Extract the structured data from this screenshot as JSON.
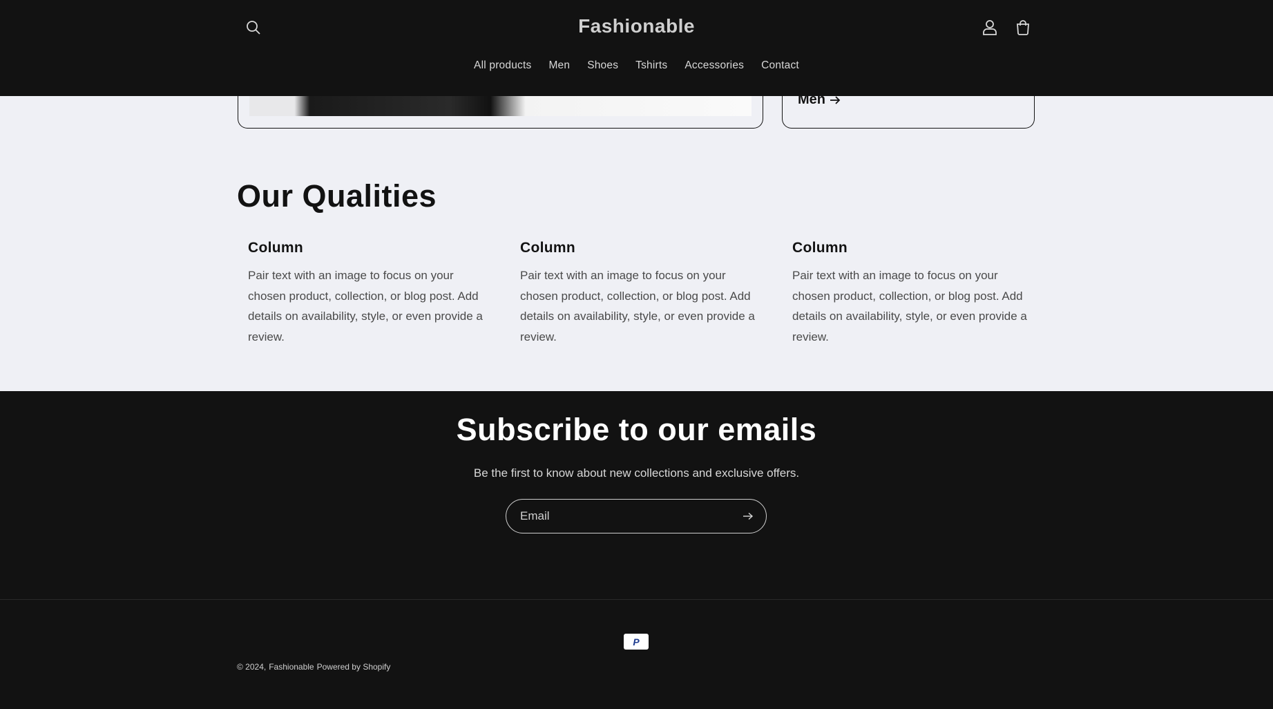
{
  "header": {
    "logo": "Fashionable",
    "nav": [
      "All products",
      "Men",
      "Shoes",
      "Tshirts",
      "Accessories",
      "Contact"
    ]
  },
  "collection_card": {
    "link_label": "Men"
  },
  "qualities": {
    "title": "Our Qualities",
    "columns": [
      {
        "heading": "Column",
        "text": "Pair text with an image to focus on your chosen product, collection, or blog post. Add details on availability, style, or even provide a review."
      },
      {
        "heading": "Column",
        "text": "Pair text with an image to focus on your chosen product, collection, or blog post. Add details on availability, style, or even provide a review."
      },
      {
        "heading": "Column",
        "text": "Pair text with an image to focus on your chosen product, collection, or blog post. Add details on availability, style, or even provide a review."
      }
    ]
  },
  "subscribe": {
    "title": "Subscribe to our emails",
    "text": "Be the first to know about new collections and exclusive offers.",
    "email_placeholder": "Email"
  },
  "footer": {
    "payment_icon": "paypal-icon",
    "payment_label": "P",
    "copyright": "© 2024,",
    "store_link": "Fashionable",
    "powered": "Powered by Shopify"
  }
}
